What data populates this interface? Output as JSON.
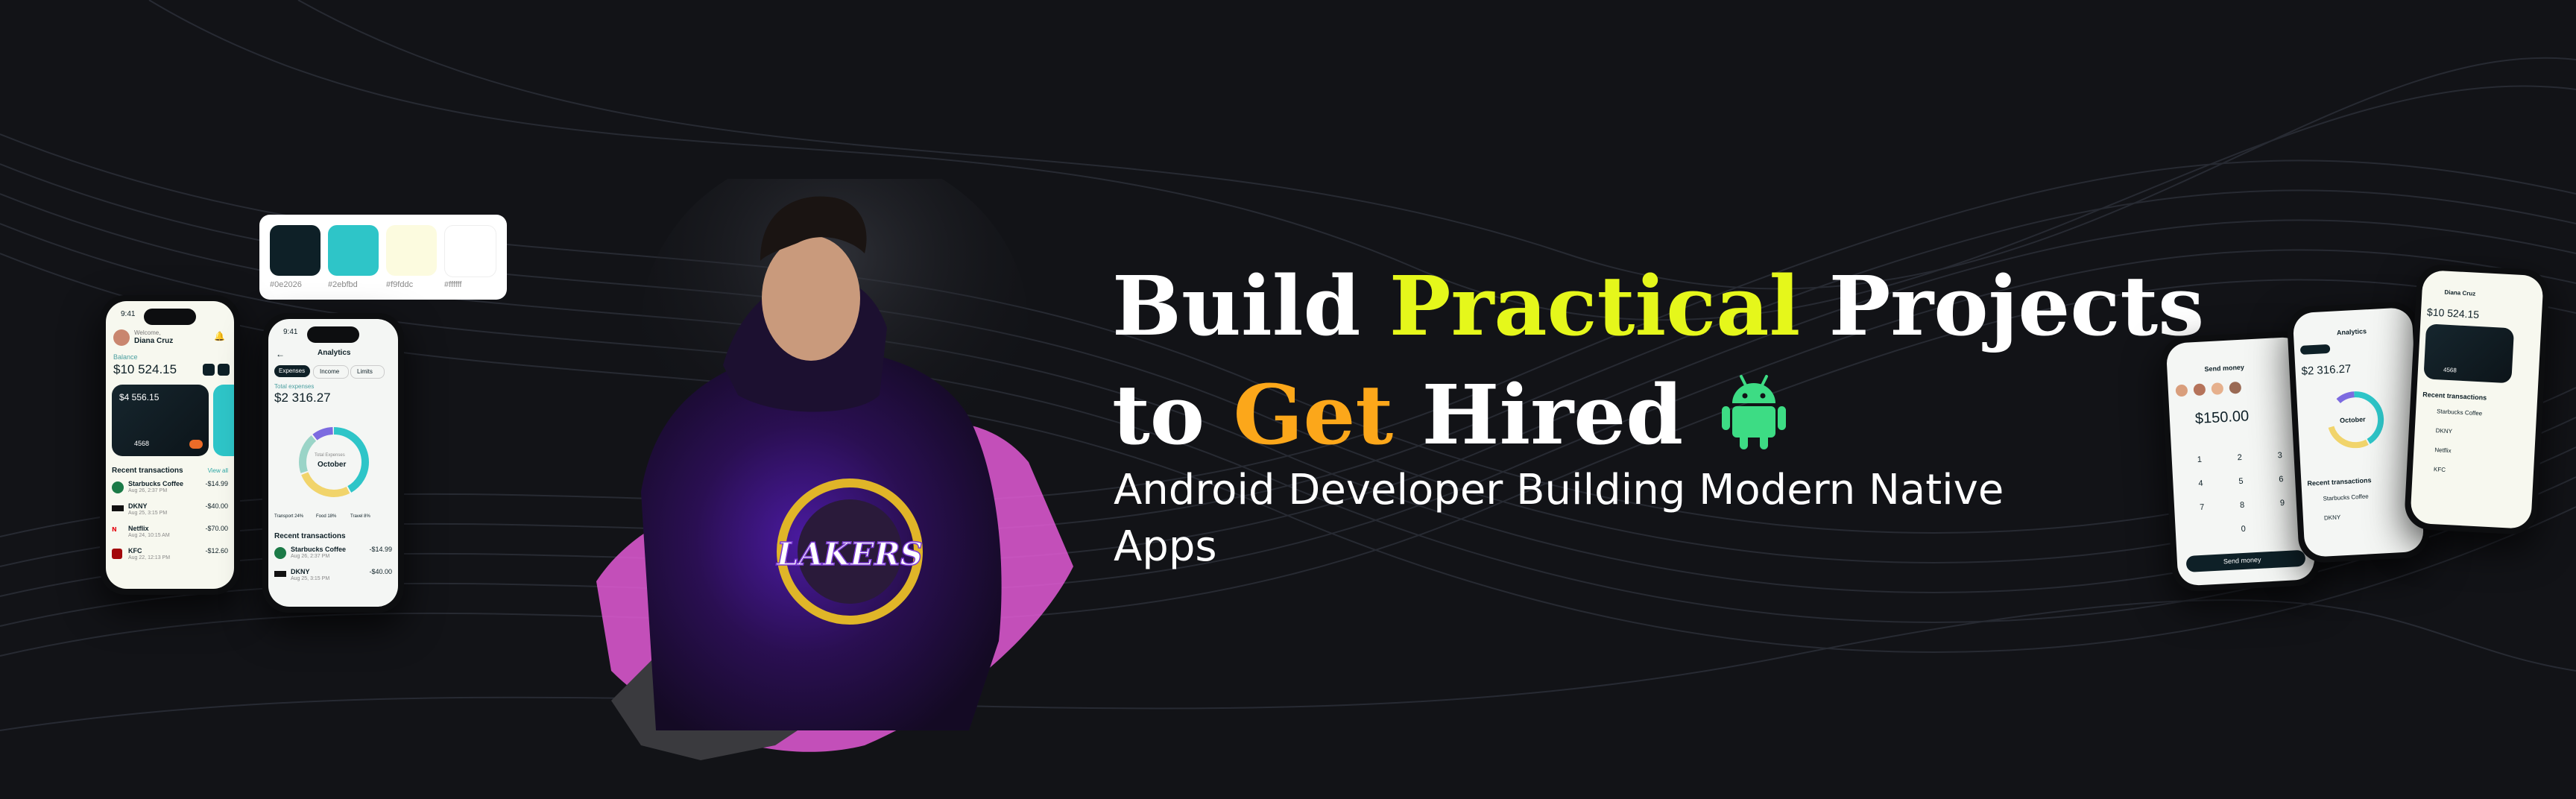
{
  "colors": {
    "background": "#121317",
    "accent_yellow": "#e5f71b",
    "accent_orange": "#fca71a",
    "android_green": "#3ddc84",
    "brush_pink": "#e35ad6"
  },
  "headline": {
    "word1": "Build",
    "word2": "Practical",
    "word3": "Projects",
    "word4": "to",
    "word5": "Get",
    "word6": "Hired",
    "icon": "android-icon"
  },
  "subtitle": "Android Developer Building Modern Native Apps",
  "palette": [
    {
      "hex": "#0e2027",
      "label": "#0e2026"
    },
    {
      "hex": "#2ec5c8",
      "label": "#2ebfbd"
    },
    {
      "hex": "#fcfbdf",
      "label": "#f9fddc"
    },
    {
      "hex": "#ffffff",
      "label": "#ffffff"
    }
  ],
  "phone1": {
    "time": "9:41",
    "welcome": "Welcome,",
    "user": "Diana Cruz",
    "balance_label": "Balance",
    "balance": "$10 524.15",
    "card_amount": "$4 556.15",
    "card_number": "4568",
    "recent": "Recent transactions",
    "view_all": "View all",
    "transactions": [
      {
        "name": "Starbucks Coffee",
        "date": "Aug 26, 2:37 PM",
        "amount": "-$14.99"
      },
      {
        "name": "DKNY",
        "date": "Aug 25, 3:15 PM",
        "amount": "-$40.00"
      },
      {
        "name": "Netflix",
        "date": "Aug 24, 10:15 AM",
        "amount": "-$70.00"
      },
      {
        "name": "KFC",
        "date": "Aug 22, 12:13 PM",
        "amount": "-$12.60"
      }
    ]
  },
  "phone2": {
    "time": "9:41",
    "title": "Analytics",
    "tabs": [
      "Expenses",
      "Income",
      "Limits"
    ],
    "total_label": "Total expenses",
    "total": "$2 316.27",
    "month_label": "Total Expenses",
    "month": "October",
    "legend": [
      "Transport 24%",
      "Food 18%",
      "Travel 8%"
    ],
    "recent": "Recent transactions",
    "transactions": [
      {
        "name": "Starbucks Coffee",
        "date": "Aug 26, 2:37 PM",
        "amount": "-$14.99"
      },
      {
        "name": "DKNY",
        "date": "Aug 25, 3:15 PM",
        "amount": "-$40.00"
      }
    ]
  },
  "phone3": {
    "title": "Send money",
    "amount": "$150.00",
    "keys": [
      "1",
      "2",
      "3",
      "4",
      "5",
      "6",
      "7",
      "8",
      "9",
      "0"
    ],
    "button": "Send money"
  },
  "phone4": {
    "title": "Analytics",
    "total": "$2 316.27",
    "month": "October",
    "recent": "Recent transactions",
    "tx1": "Starbucks Coffee",
    "tx2": "DKNY"
  },
  "phone5": {
    "user": "Diana Cruz",
    "balance": "$10 524.15",
    "card_number": "4568",
    "recent": "Recent transactions",
    "tx1": "Starbucks Coffee",
    "tx2": "DKNY",
    "tx3": "Netflix",
    "tx4": "KFC"
  },
  "hoodie_text": "LAKERS"
}
